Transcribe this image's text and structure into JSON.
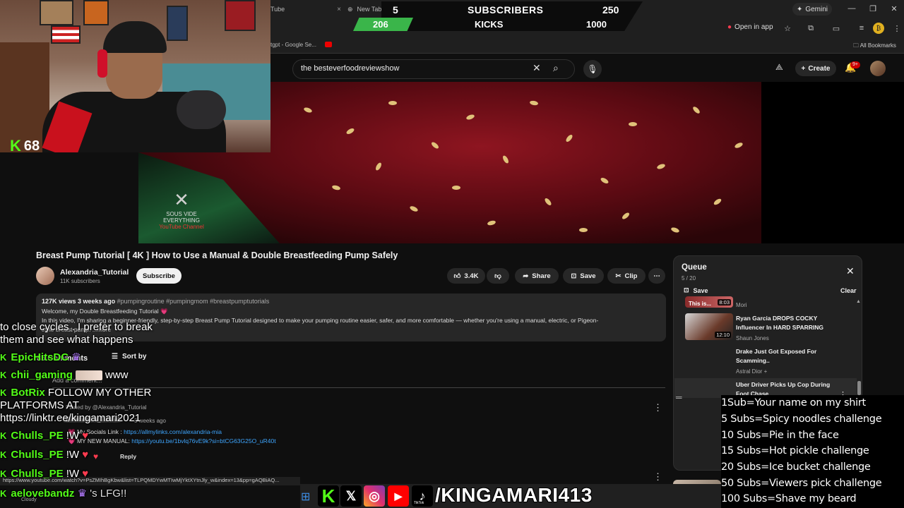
{
  "browser": {
    "tabs": [
      {
        "label": "Tube",
        "close": "×"
      },
      {
        "label": "New Tab",
        "close": "×"
      }
    ],
    "new_tab": "+",
    "gemini_label": "Gemini",
    "open_in_app": "Open in app",
    "bookmark_item": "tgpt - Google Se...",
    "all_bookmarks": "All Bookmarks",
    "status_url": "https://www.youtube.com/watch?v=PsZMIhBgKbw&list=TLPQMDYwMTIwMjYktXYtnJly_w&index=13&pp=gAQBiAQ..."
  },
  "overlay": {
    "sub_count": "5",
    "sub_label": "SUBSCRIBERS",
    "sub_goal": "250",
    "kick_count": "206",
    "kick_label": "KICKS",
    "kick_goal": "1000",
    "viewer_count": "68",
    "viewer_icon": "K"
  },
  "youtube": {
    "search_text": "the besteverfoodreviewshow",
    "create_label": "Create",
    "notif_badge": "9+"
  },
  "video": {
    "watermark_line1": "SOUS VIDE EVERYTHING",
    "watermark_line2": "YouTube Channel",
    "title": "Breast Pump Tutorial [ 4K ] How to Use a Manual & Double Breastfeeding Pump Safely",
    "channel": "Alexandria_Tutorial",
    "subscribers": "11K subscribers",
    "subscribe": "Subscribe",
    "likes": "3.4K",
    "share": "Share",
    "save": "Save",
    "clip": "Clip",
    "desc_meta": "127K views  3 weeks ago",
    "desc_tags": "#pumpingroutine #pumpingmom #breastpumptutorials",
    "desc_line1": "Welcome, my Double Breastfeeding Tutorial 💗",
    "desc_line2": "In this video, I'm sharing a beginner-friendly, step-by-step Breast Pump Tutorial designed to make your pumping routine easier, safer, and more comfortable — whether you're using a manual, electric, or Pigeon-",
    "desc_line3": "style breast pump. ...more"
  },
  "comments": {
    "count": "85 Comments",
    "sort_by": "Sort by",
    "add_placeholder": "Add a comment...",
    "pinned": "Pinned by @Alexandria_Tutorial",
    "author": "@Alexandria_Tutorial",
    "time": "3 weeks ago",
    "line1_prefix": "💗 My Socials Link : ",
    "line1_link": "https://allmylinks.com/alexandria-mia",
    "line2_prefix": "💗 MY NEW MANUAL: ",
    "line2_link": "https://youtu.be/1bvlq76vE9k?si=btCG63G25O_uR40t",
    "reply": "Reply"
  },
  "queue": {
    "title": "Queue",
    "count": "5 / 20",
    "save": "Save",
    "clear": "Clear",
    "items": [
      {
        "title": "This is...",
        "channel": "Mori",
        "duration": "8:03"
      },
      {
        "title": "Ryan Garcia DROPS COCKY Influencer In HARD SPARRING",
        "channel": "Shaun Jones",
        "duration": "12:10"
      },
      {
        "title": "Drake Just Got Exposed For Scamming..",
        "channel": "Astral Dior +",
        "duration": ""
      },
      {
        "title": "Uber Driver Picks Up Cop During Foot Chase",
        "channel": "",
        "duration": ""
      }
    ]
  },
  "chat": [
    {
      "user": "",
      "text": "to close cycles . I prefer to break"
    },
    {
      "user": "",
      "text": "them and see what happens"
    },
    {
      "user": "EpicHitsDC",
      "text": ""
    },
    {
      "user": "chii_gaming",
      "text": "www"
    },
    {
      "user": "BotRix",
      "text": "FOLLOW MY OTHER"
    },
    {
      "user": "",
      "text": "PLATFORMS AT"
    },
    {
      "user": "",
      "text": "https://linktr.ee/kingamari2021"
    },
    {
      "user": "Chulls_PE",
      "text": "!W"
    },
    {
      "user": "Chulls_PE",
      "text": "!W"
    },
    {
      "user": "Chulls_PE",
      "text": "!W"
    },
    {
      "user": "aelovebandz",
      "text": "'s LFG!!"
    }
  ],
  "sub_goals": [
    "1Sub=Your name on my shirt",
    "5 Subs=Spicy noodles challenge",
    "10 Subs=Pie in the face",
    "15 Subs=Hot pickle challenge",
    "20 Subs=Ice bucket challenge",
    "50 Subs=Viewers pick challenge",
    "100 Subs=Shave my beard"
  ],
  "socials": {
    "handle": "/KINGAMARI413",
    "tiktok_label": "TikTok",
    "weather": "Cloudy"
  },
  "colors": {
    "kick_green": "#53fc18",
    "yt_red": "#cc0000",
    "link_blue": "#3ea6ff"
  }
}
